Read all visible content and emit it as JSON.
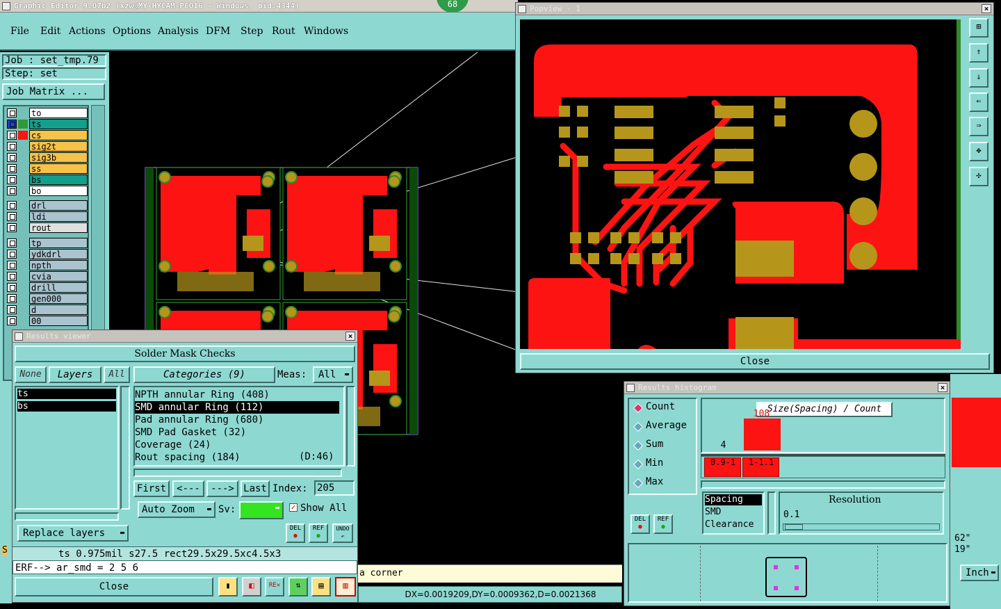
{
  "app": {
    "title": "Graphic Editor 9.07b2 (xzw@MY-HYCAM-PC016 - Windows, pid:4344)",
    "badge": "68",
    "menu": [
      "File",
      "Edit",
      "Actions",
      "Options",
      "Analysis",
      "DFM",
      "Step",
      "Rout",
      "Windows"
    ]
  },
  "left_panel": {
    "job": "Job : set_tmp.79",
    "step": "Step: set",
    "job_matrix": "Job Matrix ...",
    "layers_group1": [
      {
        "name": "to",
        "color": "#ffffff"
      },
      {
        "name": "ts",
        "color": "#12a08a"
      },
      {
        "name": "cs",
        "color": "#f6c249"
      },
      {
        "name": "sig2t",
        "color": "#f6c249"
      },
      {
        "name": "sig3b",
        "color": "#f6c249"
      },
      {
        "name": "ss",
        "color": "#f6c249"
      },
      {
        "name": "bs",
        "color": "#12a08a"
      },
      {
        "name": "bo",
        "color": "#ffffff"
      }
    ],
    "layers_group2": [
      {
        "name": "drl",
        "color": "#a9c3cf"
      },
      {
        "name": "ldi",
        "color": "#a9c3cf"
      },
      {
        "name": "rout",
        "color": "#e0e0e0"
      }
    ],
    "layers_group3": [
      {
        "name": "tp",
        "color": "#a9c3cf"
      },
      {
        "name": "ydkdrl",
        "color": "#a9c3cf"
      },
      {
        "name": "npth",
        "color": "#a9c3cf"
      },
      {
        "name": "cvia",
        "color": "#a9c3cf"
      },
      {
        "name": "drill",
        "color": "#a9c3cf"
      },
      {
        "name": "gen000",
        "color": "#a9c3cf"
      },
      {
        "name": "d",
        "color": "#a9c3cf"
      },
      {
        "name": "00",
        "color": "#a9c3cf"
      }
    ]
  },
  "results_viewer": {
    "title": "Results viewer",
    "header": "Solder Mask Checks",
    "none_btn": "None",
    "layers_btn": "Layers",
    "all_btn": "All",
    "layers": [
      "ts",
      "bs"
    ],
    "categories_btn": "Categories (9)",
    "meas_label": "Meas:",
    "meas_value": "All",
    "categories": [
      "NPTH annular Ring (408)",
      "SMD annular Ring (112)",
      "Pad annular Ring (680)",
      "SMD Pad Gasket (32)",
      "Coverage (24)",
      "Rout spacing (184)"
    ],
    "rout_extra": "(D:46)",
    "first_btn": "First",
    "prev_btn": "<---",
    "next_btn": "--->",
    "last_btn": "Last",
    "index_label": "Index:",
    "index_value": "205",
    "auto_zoom": "Auto Zoom",
    "sv_label": "Sv:",
    "show_all": "Show All",
    "replace_layers": "Replace layers",
    "del": "DEL",
    "ref": "REF",
    "undo": "UNDO",
    "status": "ts 0.975mil  s27.5  rect29.5x29.5xc4.5x3",
    "erf": "ERF--> ar_smd = 2 5 6",
    "close": "Close"
  },
  "popview": {
    "title": "Popview - 1",
    "close": "Close"
  },
  "histogram": {
    "title": "Results histogram",
    "modes": [
      "Count",
      "Average",
      "Sum",
      "Min",
      "Max"
    ],
    "chart_title": "Size(Spacing) / Count",
    "del": "DEL",
    "ref": "REF",
    "list": [
      "Spacing",
      "SMD",
      "Clearance"
    ],
    "resolution_label": "Resolution",
    "resolution_value": "0.1",
    "chart_data": {
      "type": "bar",
      "categories": [
        "0.9-1",
        "1-1.1"
      ],
      "values": [
        4,
        108
      ]
    }
  },
  "bottom": {
    "corner_text": "a corner",
    "coords": "DX=0.0019209,DY=0.0009362,D=0.0021368",
    "unit": "Inch",
    "right_vals": [
      "62\"",
      "19\""
    ]
  },
  "colors": {
    "copper": "#fe1313",
    "pad": "#b5961a",
    "panel": "#8ed8d2"
  }
}
